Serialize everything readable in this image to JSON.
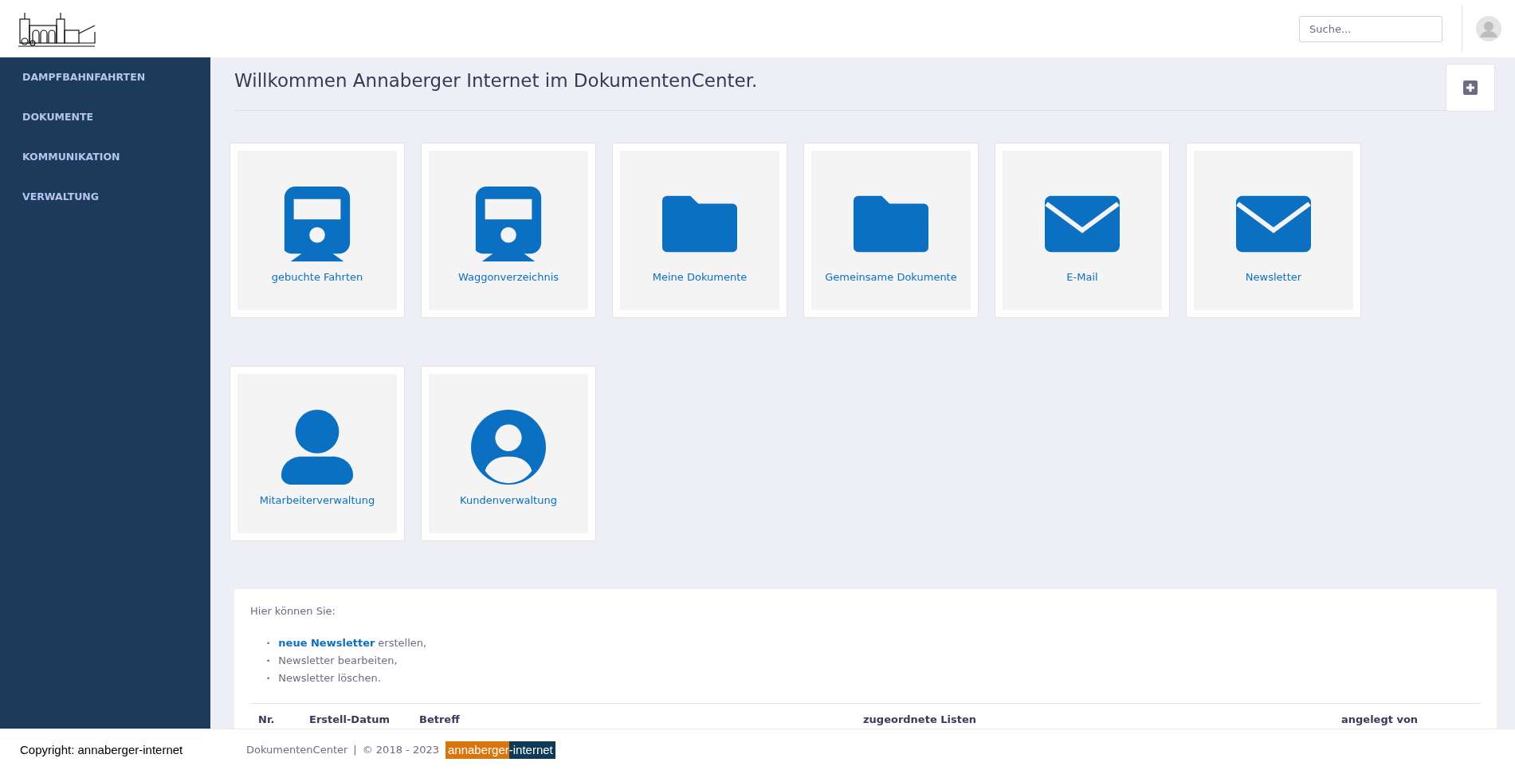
{
  "header": {
    "search": {
      "placeholder": "Suche..."
    }
  },
  "sidebar": {
    "items": [
      {
        "label": "DAMPFBAHNFAHRTEN"
      },
      {
        "label": "DOKUMENTE"
      },
      {
        "label": "KOMMUNIKATION"
      },
      {
        "label": "VERWALTUNG"
      }
    ]
  },
  "page": {
    "title": "Willkommen Annaberger Internet im DokumentenCenter."
  },
  "tiles": [
    {
      "kind": "train",
      "label": "gebuchte Fahrten"
    },
    {
      "kind": "train",
      "label": "Waggonverzeichnis"
    },
    {
      "kind": "folder",
      "label": "Meine Dokumente"
    },
    {
      "kind": "folder",
      "label": "Gemeinsame Dokumente"
    },
    {
      "kind": "mail",
      "label": "E-Mail"
    },
    {
      "kind": "mail",
      "label": "Newsletter"
    },
    {
      "kind": "user",
      "label": "Mitarbeiterverwaltung"
    },
    {
      "kind": "user-circle",
      "label": "Kundenverwaltung"
    }
  ],
  "info": {
    "intro": "Hier können Sie:",
    "items": [
      {
        "bullet": "•",
        "link": "neue Newsletter",
        "text": "erstellen,"
      },
      {
        "bullet": "•",
        "text": "Newsletter bearbeiten,"
      },
      {
        "bullet": "•",
        "text": "Newsletter löschen."
      }
    ]
  },
  "table": {
    "columns": [
      "Nr.",
      "Erstell-Datum",
      "Betreff",
      "zugeordnete Listen",
      "angelegt von"
    ]
  },
  "footer": {
    "copyright": "Copyright: annaberger-internet",
    "app": "DokumentenCenter",
    "separator": "|",
    "years": "© 2018 - 2023",
    "brand_left": "annaberger",
    "brand_right": "-internet"
  }
}
